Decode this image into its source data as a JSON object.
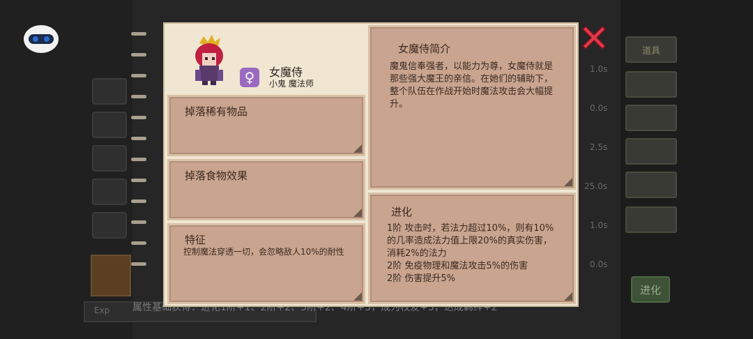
{
  "character": {
    "name": "女魔侍",
    "classes": "小鬼 魔法师",
    "gender_symbol": "♀"
  },
  "panels": {
    "rare_drop_title": "掉落稀有物品",
    "food_drop_title": "掉落食物效果",
    "trait": {
      "title": "特征",
      "text": "控制魔法穿透一切，会忽略敌人10%的耐性"
    },
    "intro": {
      "title": "女魔侍简介",
      "text": "魔鬼信奉强者，以能力为尊，女魔侍就是那些强大魔王的亲信。在她们的辅助下，整个队伍在作战开始时魔法攻击会大幅提升。"
    },
    "evolution": {
      "title": "进化",
      "lines": [
        "1阶 攻击时，若法力超过10%，则有10%的几率造成法力值上限20%的真实伤害，消耗2%的法力",
        "2阶 免疫物理和魔法攻击5%的伤害",
        "2阶 伤害提升5%"
      ]
    }
  },
  "background": {
    "side_buttons": [
      "道具",
      "",
      "",
      "",
      "",
      ""
    ],
    "times": [
      "1.0s",
      "0.0s",
      "2.5s",
      "25.0s",
      "1.0s",
      "0.0s"
    ],
    "bottom_text": "属性基础获得：进化1阶+1、2阶+2、3阶+2、4阶+3，成为权友+3，达成羁绊+2",
    "exp_label": "Exp",
    "evolve_button": "进化"
  },
  "colors": {
    "modal_bg": "#f0e6d2",
    "card_bg": "#c9a48e",
    "close_red": "#e0394a",
    "badge_purple": "#9a6ac0"
  }
}
